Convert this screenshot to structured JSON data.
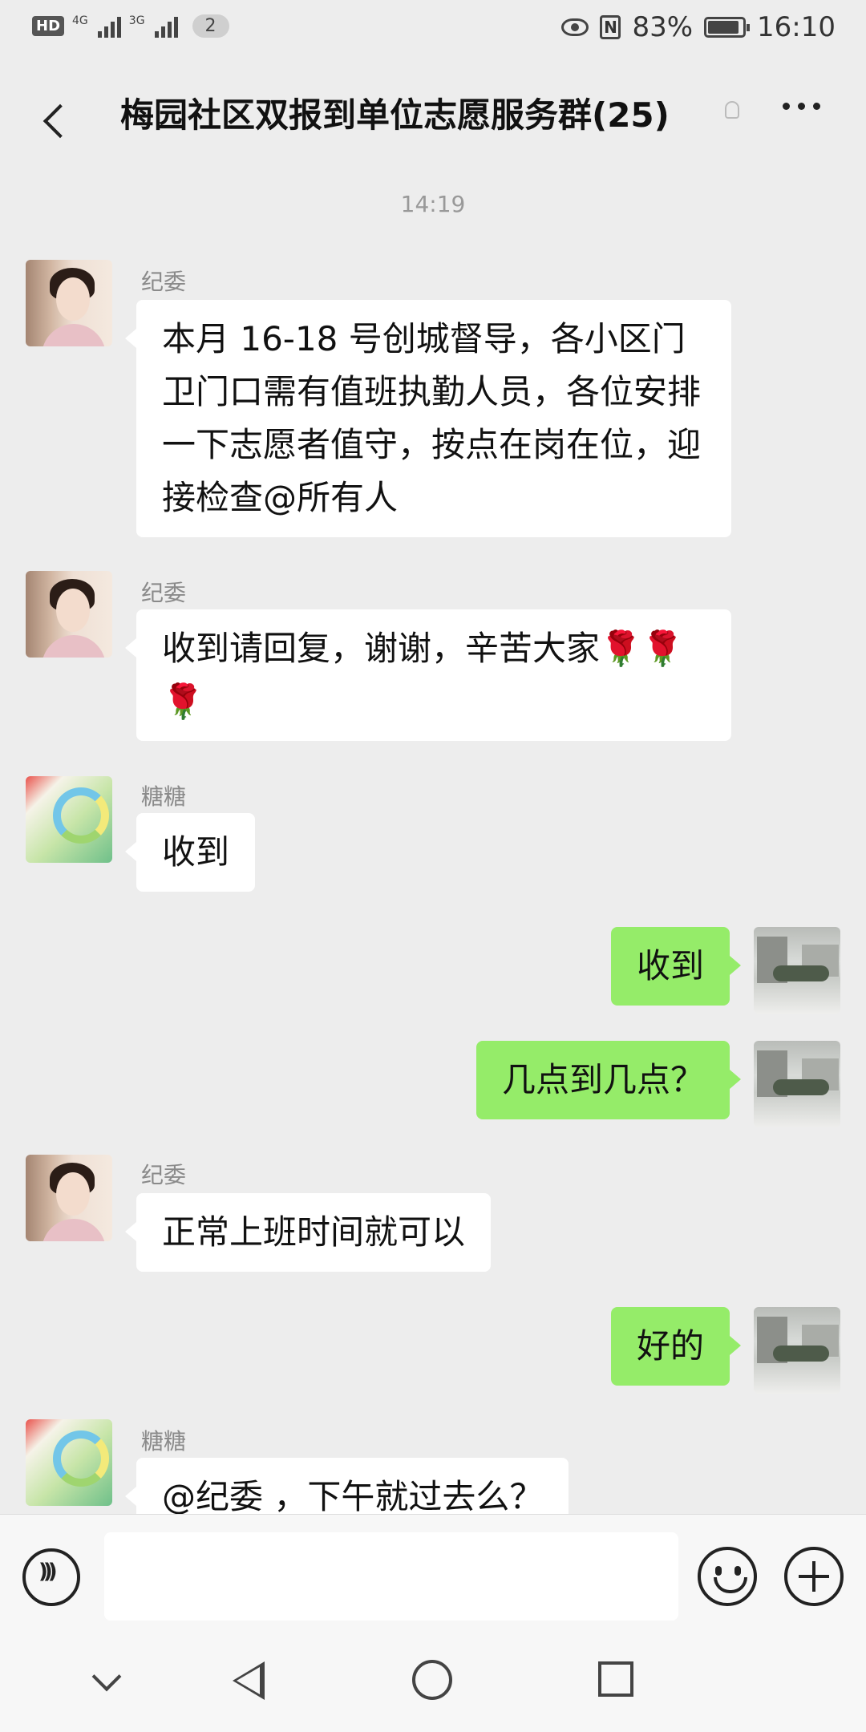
{
  "status_bar": {
    "hd": "HD",
    "sim1": "4G",
    "sim2": "3G",
    "notification_count": "2",
    "nfc": "N",
    "battery": "83%",
    "time": "16:10"
  },
  "header": {
    "title": "梅园社区双报到单位志愿服务群(25)"
  },
  "chat": {
    "timestamp": "14:19",
    "messages": [
      {
        "sender": "纪委",
        "text": "本月 16-18 号创城督导，各小区门卫门口需有值班执勤人员，各位安排一下志愿者值守，按点在岗在位，迎接检查@所有人",
        "direction": "in",
        "avatar": "portrait"
      },
      {
        "sender": "纪委",
        "text": "收到请回复，谢谢，辛苦大家🌹🌹🌹",
        "direction": "in",
        "avatar": "portrait"
      },
      {
        "sender": "糖糖",
        "text": "收到",
        "direction": "in",
        "avatar": "candy"
      },
      {
        "sender": "",
        "text": "收到",
        "direction": "out",
        "avatar": "snow-scene"
      },
      {
        "sender": "",
        "text": "几点到几点？",
        "direction": "out",
        "avatar": "snow-scene"
      },
      {
        "sender": "纪委",
        "text": "正常上班时间就可以",
        "direction": "in",
        "avatar": "portrait"
      },
      {
        "sender": "",
        "text": "好的",
        "direction": "out",
        "avatar": "snow-scene"
      },
      {
        "sender": "糖糖",
        "text": "@纪委 ，下午就过去么？",
        "direction": "in",
        "avatar": "candy"
      }
    ]
  },
  "input_bar": {
    "placeholder": ""
  },
  "icons": {
    "back": "chevron-left-icon",
    "more": "more-icon",
    "mute": "mute-icon",
    "voice": "voice-icon",
    "emoji": "emoji-icon",
    "plus": "plus-icon"
  },
  "colors": {
    "chat_bg": "#ededed",
    "bubble_in": "#ffffff",
    "bubble_out": "#95ec69"
  }
}
